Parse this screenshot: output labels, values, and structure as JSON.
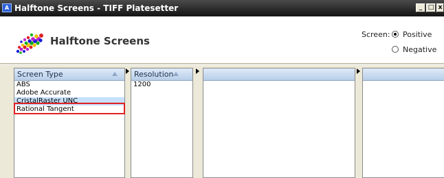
{
  "window": {
    "title": "Halftone Screens - TIFF Platesetter",
    "icon_text": "A",
    "controls": {
      "minimize": "_",
      "maximize": "□",
      "close": "x"
    }
  },
  "header": {
    "title": "Halftone Screens",
    "screen_label": "Screen:",
    "options": [
      {
        "label": "Positive",
        "checked": true
      },
      {
        "label": "Negative",
        "checked": false
      }
    ]
  },
  "columns": [
    {
      "header": "Screen Type",
      "items": [
        "ABS",
        "Adobe Accurate",
        "CristalRaster UNC",
        "Rational Tangent"
      ],
      "selected": "CristalRaster UNC"
    },
    {
      "header": "Resolution",
      "items": [
        "1200"
      ]
    },
    {
      "header": "",
      "items": []
    },
    {
      "header": "",
      "items": []
    }
  ],
  "colors": {
    "titlebar": "#141414",
    "selection": "#c7e0fb",
    "highlight_box": "#e02020",
    "column_header": "#b8cfe9"
  }
}
